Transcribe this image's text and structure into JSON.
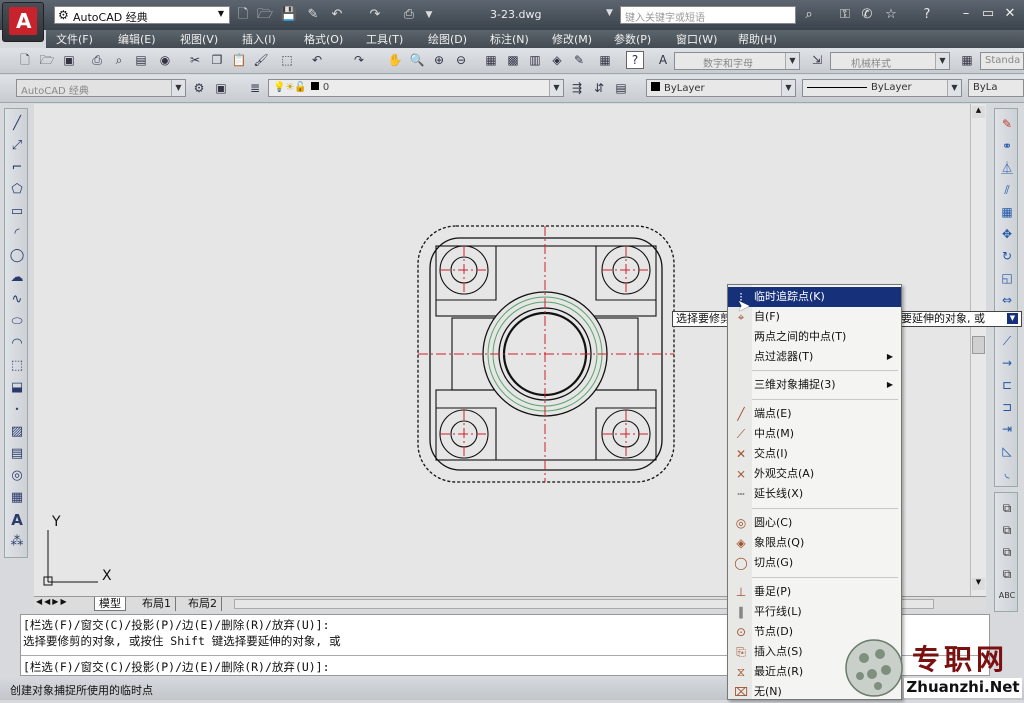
{
  "title_bar": {
    "workspace": "AutoCAD 经典",
    "document_title": "3-23.dwg",
    "search_placeholder": "键入关键字或短语"
  },
  "menu": [
    "文件(F)",
    "编辑(E)",
    "视图(V)",
    "插入(I)",
    "格式(O)",
    "工具(T)",
    "绘图(D)",
    "标注(N)",
    "修改(M)",
    "参数(P)",
    "窗口(W)",
    "帮助(H)"
  ],
  "toolbar": {
    "text_style": "数字和字母",
    "dim_style": "机械样式",
    "table_style": "Standa",
    "workspace_combo": "AutoCAD 经典",
    "layer_value": "0",
    "color_value": "ByLayer",
    "linetype_value": "ByLayer",
    "lineweight_value": "ByLa"
  },
  "layout_tabs": [
    "模型",
    "布局1",
    "布局2"
  ],
  "ucs": {
    "x": "X",
    "y": "Y"
  },
  "command_lines": [
    "[栏选(F)/窗交(C)/投影(P)/边(E)/删除(R)/放弃(U)]:",
    "选择要修剪的对象, 或按住 Shift 键选择要延伸的对象, 或",
    "[栏选(F)/窗交(C)/投影(P)/边(E)/删除(R)/放弃(U)]:"
  ],
  "status_text": "创建对象捕捉所使用的临时点",
  "tooltip": {
    "left": "选择要修剪",
    "right": "要延伸的对象, 或"
  },
  "context_menu": [
    {
      "label": "临时追踪点(K)",
      "icon": "temp-track-icon",
      "highlighted": true
    },
    {
      "label": "自(F)",
      "icon": "from-icon"
    },
    {
      "label": "两点之间的中点(T)",
      "icon": ""
    },
    {
      "label": "点过滤器(T)",
      "icon": "",
      "submenu": true
    },
    {
      "label": "三维对象捕捉(3)",
      "icon": "",
      "submenu": true
    },
    {
      "label": "端点(E)",
      "icon": "endpoint-icon"
    },
    {
      "label": "中点(M)",
      "icon": "midpoint-icon"
    },
    {
      "label": "交点(I)",
      "icon": "intersection-icon"
    },
    {
      "label": "外观交点(A)",
      "icon": "apparent-intersection-icon"
    },
    {
      "label": "延长线(X)",
      "icon": "extension-icon"
    },
    {
      "label": "圆心(C)",
      "icon": "center-icon"
    },
    {
      "label": "象限点(Q)",
      "icon": "quadrant-icon"
    },
    {
      "label": "切点(G)",
      "icon": "tangent-icon"
    },
    {
      "label": "垂足(P)",
      "icon": "perpendicular-icon"
    },
    {
      "label": "平行线(L)",
      "icon": "parallel-icon"
    },
    {
      "label": "节点(D)",
      "icon": "node-icon"
    },
    {
      "label": "插入点(S)",
      "icon": "insert-icon"
    },
    {
      "label": "最近点(R)",
      "icon": "nearest-icon"
    },
    {
      "label": "无(N)",
      "icon": "none-icon"
    }
  ],
  "watermark": {
    "cn": "专职网",
    "url": "Zhuanzhi.Net"
  },
  "colors": {
    "highlight": "#16307a",
    "centerline": "#d0202a",
    "green_arc": "#5aa36a"
  }
}
